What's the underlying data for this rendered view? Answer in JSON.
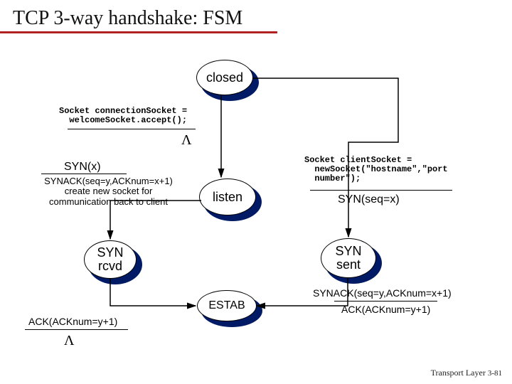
{
  "title": "TCP 3-way handshake: FSM",
  "footer": {
    "label": "Transport Layer",
    "page": "3-81"
  },
  "states": {
    "closed": "closed",
    "listen": "listen",
    "synrcvd1": "SYN",
    "synrcvd2": "rcvd",
    "synsent1": "SYN",
    "synsent2": "sent",
    "estab": "ESTAB"
  },
  "labels": {
    "serverCode": "Socket connectionSocket =\n  welcomeSocket.accept();",
    "lambda1": "Λ",
    "synx": "SYN(x)",
    "synackAction": "SYNACK(seq=y,ACKnum=x+1)\ncreate new socket for\ncommunication back to client",
    "clientCode": "Socket clientSocket =\n  newSocket(\"hostname\",\"port\n  number\");",
    "synseqx": "SYN(seq=x)",
    "ackEvt": "ACK(ACKnum=y+1)",
    "lambda2": "Λ",
    "synackEvt": "SYNACK(seq=y,ACKnum=x+1)",
    "ackAct": "ACK(ACKnum=y+1)"
  }
}
